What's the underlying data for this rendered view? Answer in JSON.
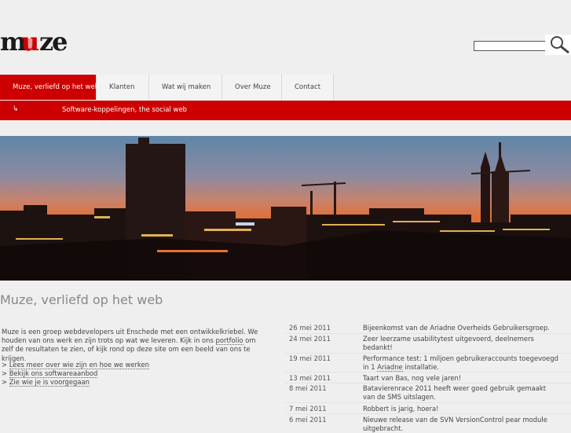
{
  "logo": {
    "text": "muze"
  },
  "search": {
    "placeholder": ""
  },
  "nav": {
    "items": [
      {
        "label": "Muze, verliefd op het web"
      },
      {
        "label": "Klanten"
      },
      {
        "label": "Wat wij maken"
      },
      {
        "label": "Over Muze"
      },
      {
        "label": "Contact"
      }
    ]
  },
  "subnav": {
    "arrow": "↳",
    "item": "Software-koppelingen, the social web"
  },
  "page": {
    "title": "Muze, verliefd op het web",
    "intro_before": "Muze is een groep webdevelopers uit Enschede met een ontwikkelkriebel. We houden van ons werk en zijn trots op wat we leveren. Kijk in ons ",
    "intro_link": "portfolio",
    "intro_after": " om zelf de resultaten te zien, of kijk rond op deze site om een beeld van ons te krijgen.",
    "links": [
      {
        "prefix": "> ",
        "label": "Lees meer over wie zijn en hoe we werken"
      },
      {
        "prefix": "> ",
        "label": "Bekijk ons softwareaanbod"
      },
      {
        "prefix": "> ",
        "label": "Zie wie je is voorgegaan"
      }
    ]
  },
  "news": [
    {
      "date": "26 mei 2011",
      "text": "Bijeenkomst van de Ariadne Overheids Gebruikersgroep."
    },
    {
      "date": "24 mei 2011",
      "text": "Zeer leerzame usabilitytest uitgevoerd, deelnemers bedankt!"
    },
    {
      "date": "19 mei 2011",
      "text_before": "Performance test: 1 miljoen gebruikeraccounts toegevoegd in 1 ",
      "link": "Ariadne",
      "text_after": " installatie."
    },
    {
      "date": "13 mei 2011",
      "text": "Taart van Bas, nog vele jaren!"
    },
    {
      "date": "8 mei 2011",
      "text": "Batavierenrace 2011 heeft weer goed gebruik gemaakt van de SMS uitslagen."
    },
    {
      "date": "7 mei 2011",
      "text": "Robbert is jarig, hoera!"
    },
    {
      "date": "6 mei 2011",
      "text": "Nieuwe release van de SVN VersionControl pear module uitgebracht."
    }
  ],
  "colors": {
    "accent": "#cc0000",
    "background": "#efefef"
  }
}
